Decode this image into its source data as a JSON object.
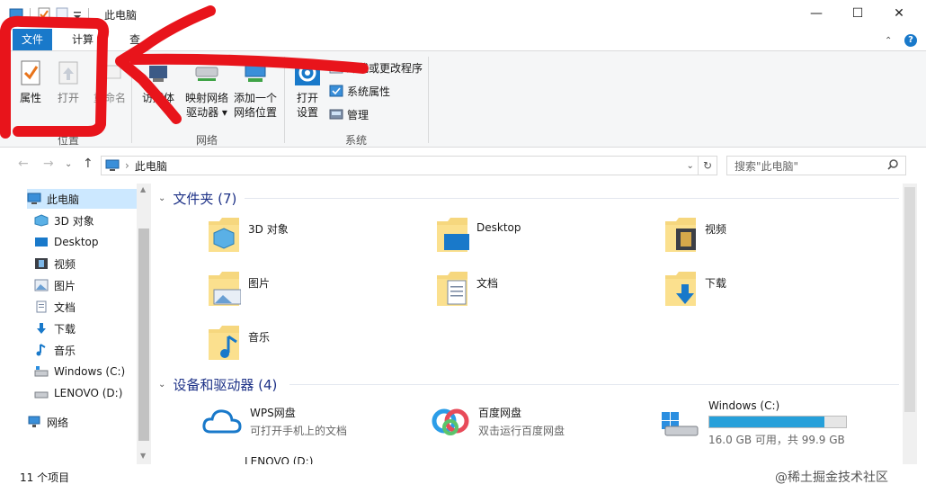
{
  "window": {
    "title": "此电脑",
    "minimize": "—",
    "maximize": "☐",
    "close": "✕"
  },
  "tabs": [
    {
      "label": "文件"
    },
    {
      "label": "计算"
    },
    {
      "label": "查"
    }
  ],
  "ribbon": {
    "location": {
      "label": "位置",
      "buttons": [
        {
          "label": "属性",
          "icon": "properties-icon"
        },
        {
          "label": "打开",
          "icon": "open-icon"
        },
        {
          "label": "重命名",
          "icon": "rename-icon"
        }
      ]
    },
    "network": {
      "label": "网络",
      "buttons": [
        {
          "label_line1": "访",
          "label_line2": "媒体",
          "icon": "media-icon"
        },
        {
          "label_line1": "映射网络",
          "label_line2": "驱动器 ▾",
          "icon": "map-drive-icon"
        },
        {
          "label_line1": "添加一个",
          "label_line2": "网络位置",
          "icon": "network-location-icon"
        }
      ]
    },
    "system": {
      "label": "系统",
      "open_settings_line1": "打开",
      "open_settings_line2": "设置",
      "small": [
        {
          "label": "卸载或更改程序"
        },
        {
          "label": "系统属性"
        },
        {
          "label": "管理"
        }
      ]
    }
  },
  "address": {
    "path": "此电脑",
    "search_placeholder": "搜索\"此电脑\""
  },
  "nav": [
    {
      "label": "此电脑",
      "icon": "computer-icon"
    },
    {
      "label": "3D 对象",
      "icon": "3d-objects-icon"
    },
    {
      "label": "Desktop",
      "icon": "desktop-icon"
    },
    {
      "label": "视频",
      "icon": "video-icon"
    },
    {
      "label": "图片",
      "icon": "picture-icon"
    },
    {
      "label": "文档",
      "icon": "document-icon"
    },
    {
      "label": "下载",
      "icon": "download-icon"
    },
    {
      "label": "音乐",
      "icon": "music-icon"
    },
    {
      "label": "Windows (C:)",
      "icon": "drive-icon"
    },
    {
      "label": "LENOVO (D:)",
      "icon": "drive-icon"
    },
    {
      "label": "网络",
      "icon": "network-icon"
    }
  ],
  "folders_section": {
    "title": "文件夹 (7)"
  },
  "folders": [
    {
      "label": "3D 对象"
    },
    {
      "label": "Desktop"
    },
    {
      "label": "视频"
    },
    {
      "label": "图片"
    },
    {
      "label": "文档"
    },
    {
      "label": "下载"
    },
    {
      "label": "音乐"
    }
  ],
  "drives_section": {
    "title": "设备和驱动器 (4)"
  },
  "devices": [
    {
      "name": "WPS网盘",
      "sub": "可打开手机上的文档"
    },
    {
      "name": "百度网盘",
      "sub": "双击运行百度网盘"
    },
    {
      "name": "Windows (C:)",
      "sub": "16.0 GB 可用，共 99.9 GB",
      "used_fraction": 0.84
    },
    {
      "name": "LENOVO (D:)",
      "sub": ""
    }
  ],
  "status": {
    "count": "11 个项目"
  },
  "watermark": "@稀土掘金技术社区",
  "colors": {
    "accent": "#1979ca",
    "annotation": "#e8141b",
    "section_title": "#1e3287",
    "drive_bar": "#26a0da"
  }
}
